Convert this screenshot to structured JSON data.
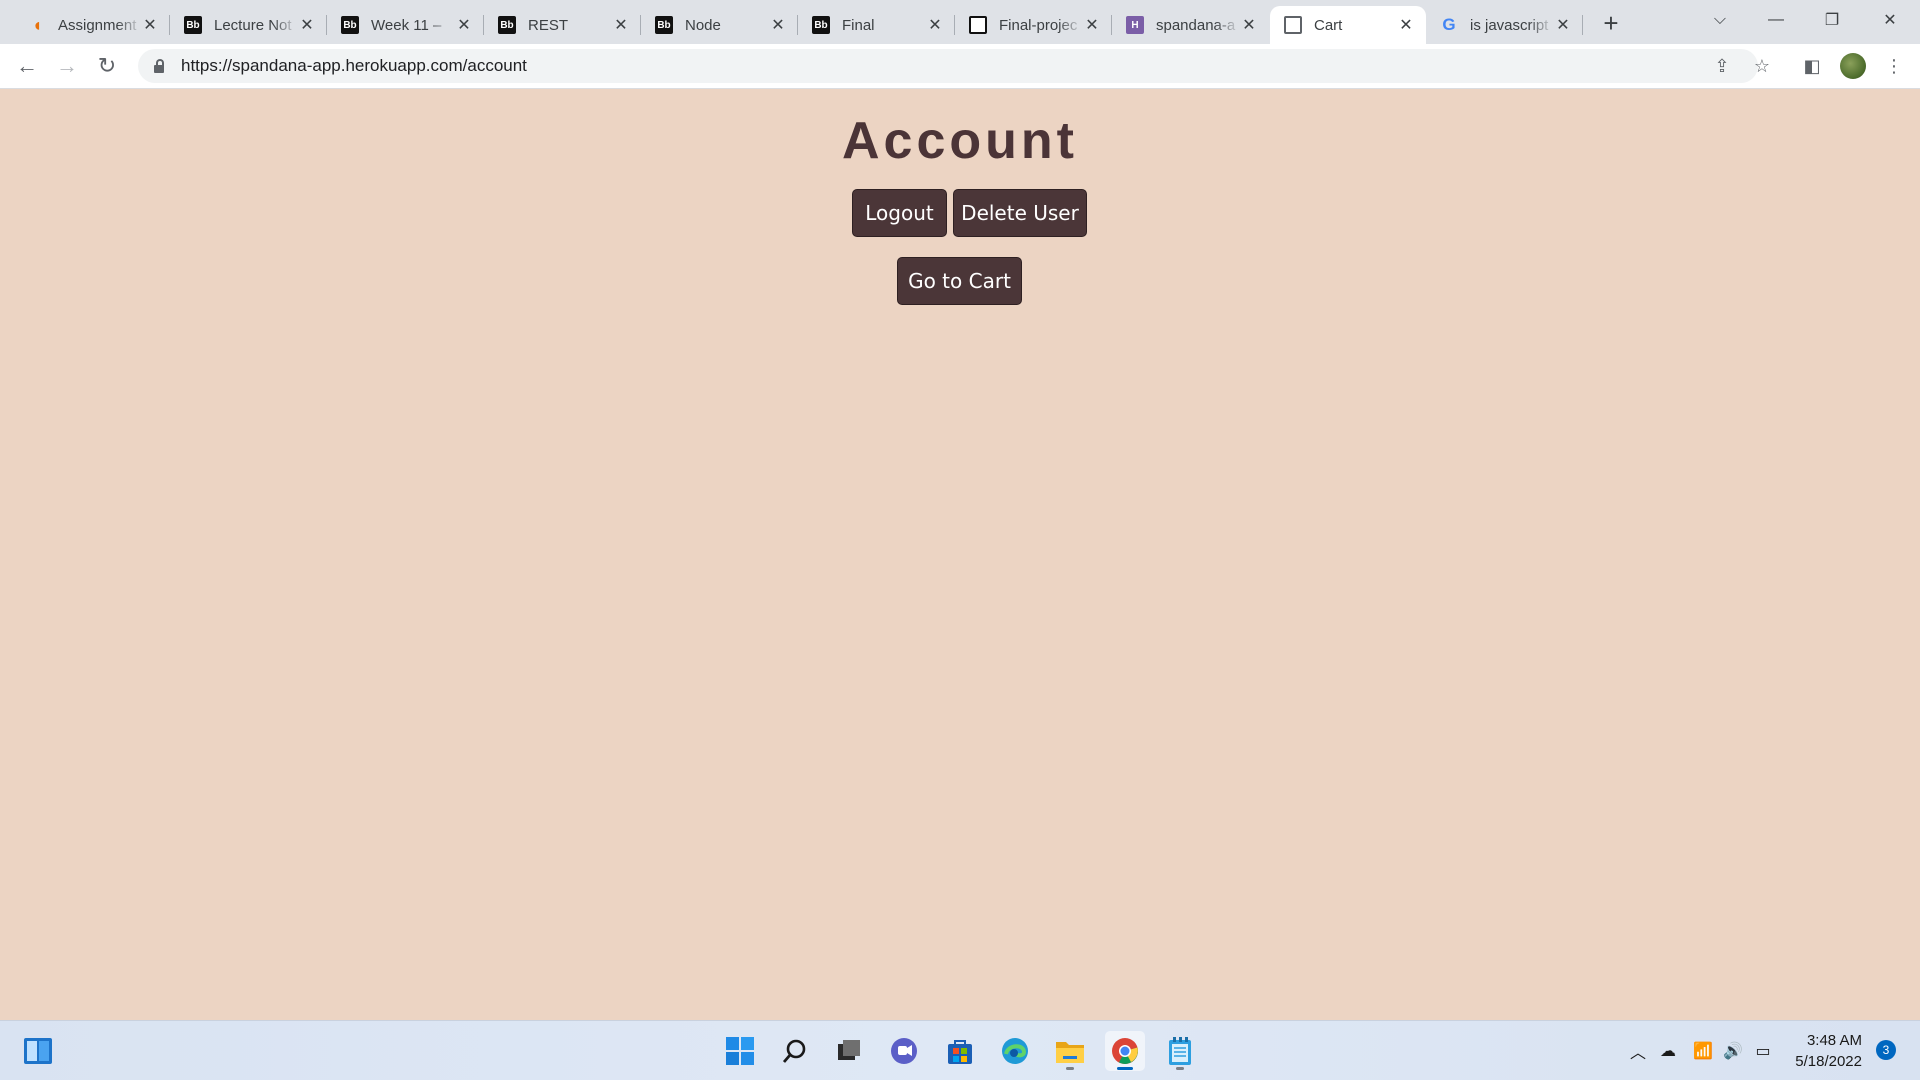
{
  "browser": {
    "tabs": [
      {
        "title": "Assignment",
        "favicon": "orange-logo-icon"
      },
      {
        "title": "Lecture Not",
        "favicon": "blackboard-icon"
      },
      {
        "title": "Week 11 – ",
        "favicon": "blackboard-icon"
      },
      {
        "title": "REST",
        "favicon": "blackboard-icon"
      },
      {
        "title": "Node",
        "favicon": "blackboard-icon"
      },
      {
        "title": "Final",
        "favicon": "blackboard-icon"
      },
      {
        "title": "Final-projec",
        "favicon": "github-icon"
      },
      {
        "title": "spandana-a",
        "favicon": "heroku-icon"
      },
      {
        "title": "Cart",
        "favicon": "globe-icon",
        "active": true
      },
      {
        "title": "is javascript",
        "favicon": "google-icon"
      }
    ],
    "url": "https://spandana-app.herokuapp.com/account"
  },
  "page": {
    "title": "Account",
    "logout_label": "Logout",
    "delete_label": "Delete User",
    "cart_label": "Go to Cart",
    "background_color": "#ecd4c3",
    "button_color": "#4b3638",
    "title_color": "#4b3437"
  },
  "taskbar": {
    "time": "3:48 AM",
    "date": "5/18/2022",
    "notification_count": "3"
  }
}
